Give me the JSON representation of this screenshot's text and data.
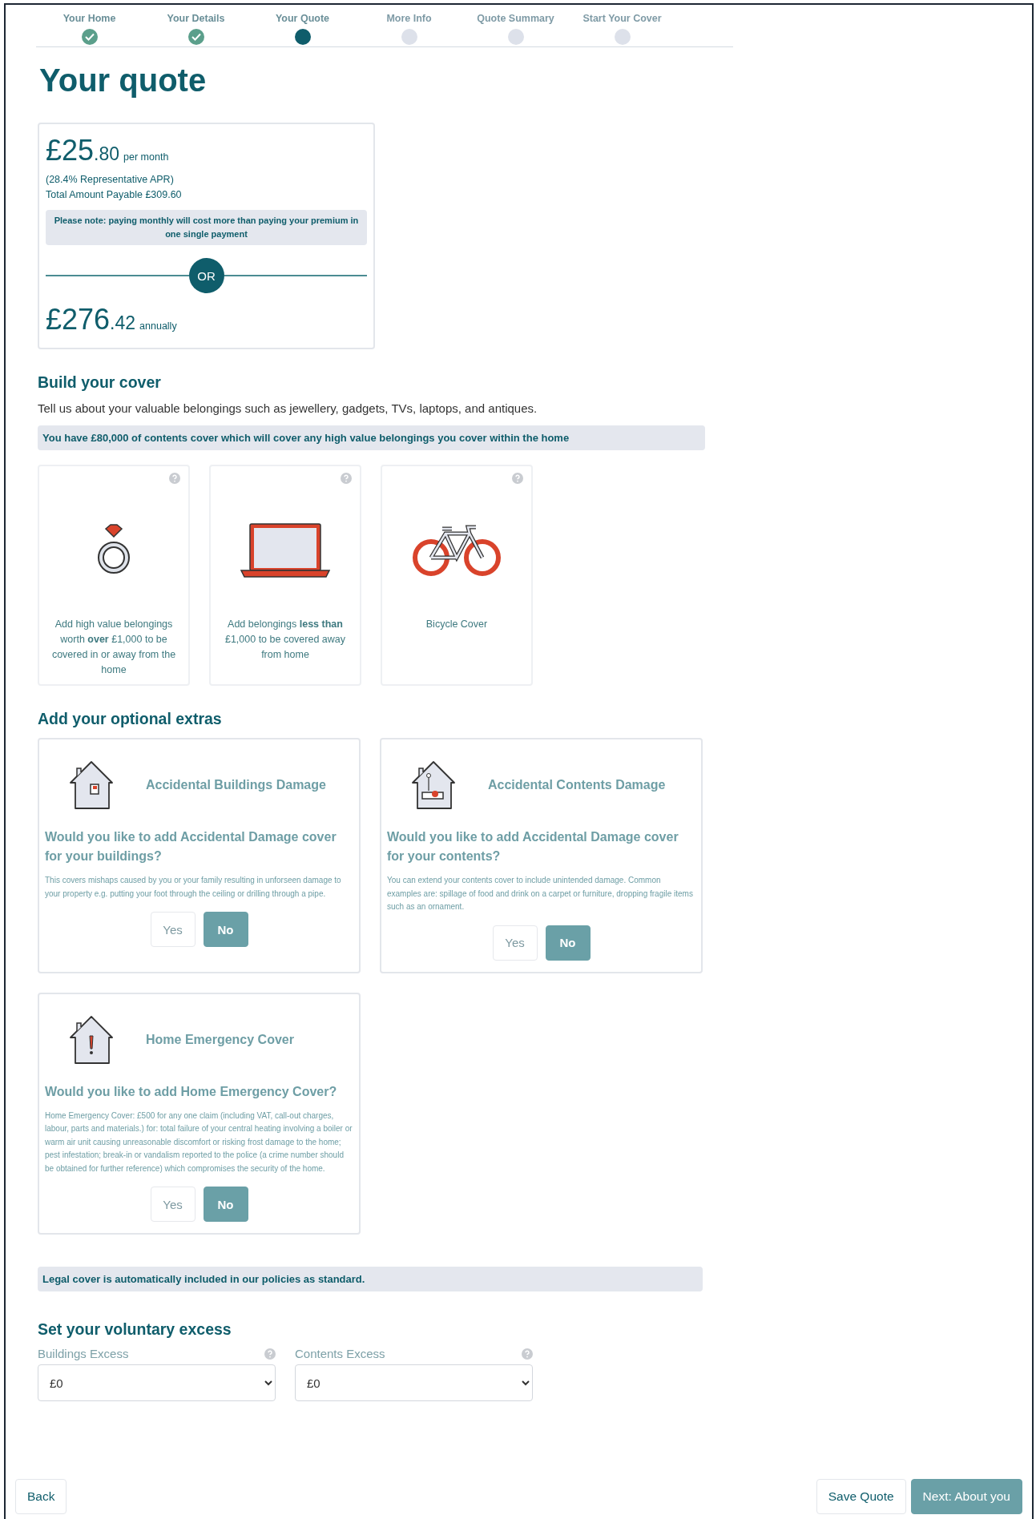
{
  "steps": [
    {
      "label": "Your Home",
      "completed": true,
      "selected": false
    },
    {
      "label": "Your Details",
      "completed": true,
      "selected": false
    },
    {
      "label": "Your Quote",
      "completed": false,
      "selected": true
    },
    {
      "label": "More Info",
      "completed": false,
      "selected": false
    },
    {
      "label": "Quote Summary",
      "completed": false,
      "selected": false
    },
    {
      "label": "Start Your Cover",
      "completed": false,
      "selected": false
    }
  ],
  "title": "Your quote",
  "quote": {
    "monthly": {
      "pounds": "£25",
      "pence": ".80",
      "period": "per month"
    },
    "apr": "(28.4% Representative APR)",
    "total": "Total Amount Payable £309.60",
    "note": "**Please note:** paying monthly will cost more than paying your premium in one single payment",
    "divider": "OR",
    "annual": {
      "pounds": "£276",
      "pence": ".42",
      "period": "annually"
    }
  },
  "build": {
    "heading": "Build your cover",
    "intro": "Tell us about your valuable belongings such as jewellery, gadgets, TVs, laptops, and antiques.",
    "info": "You have £80,000 of contents cover which will cover any high value belongings you cover within the home",
    "cards": [
      {
        "kind": "ring",
        "text": "Add high value belongings worth **over** £1,000 to be covered in or away from the home"
      },
      {
        "kind": "laptop",
        "text": "Add belongings **less than** £1,000 to be covered away from home"
      },
      {
        "kind": "bicycle",
        "text": "Bicycle Cover"
      }
    ]
  },
  "extras": {
    "heading": "Add your optional extras",
    "cards": [
      {
        "kind": "buildings",
        "title": "Accidental Buildings Damage",
        "question": "Would you like to add Accidental Damage cover for your buildings?",
        "description": "This covers mishaps caused by you or your family resulting in unforseen damage to your property e.g. putting your foot through the ceiling or drilling through a pipe.",
        "options": [
          {
            "label": "Yes",
            "selected": false
          },
          {
            "label": "No",
            "selected": true
          }
        ]
      },
      {
        "kind": "contents",
        "title": "Accidental Contents Damage",
        "question": "Would you like to add Accidental Damage cover for your contents?",
        "description": "You can extend your contents cover to include unintended damage. Common examples are: spillage of food and drink on a carpet or furniture, dropping fragile items such as an ornament.",
        "options": [
          {
            "label": "Yes",
            "selected": false
          },
          {
            "label": "No",
            "selected": true
          }
        ]
      },
      {
        "kind": "emergency",
        "title": "Home Emergency Cover",
        "question": "Would you like to add Home Emergency Cover?",
        "description": "Home Emergency Cover: £500 for any one claim (including VAT, call-out charges, labour, parts and materials.) for: total failure of your central heating involving a boiler or warm air unit causing unreasonable discomfort or risking frost damage to the home; pest infestation; break-in or vandalism reported to the police (a crime number should be obtained for further reference) which compromises the security of the home.",
        "options": [
          {
            "label": "Yes",
            "selected": false
          },
          {
            "label": "No",
            "selected": true
          }
        ]
      }
    ]
  },
  "legal": "Legal cover is automatically included in our policies as standard.",
  "excess": {
    "heading": "Set your voluntary excess",
    "fields": [
      {
        "label": "Buildings Excess",
        "value": "£0"
      },
      {
        "label": "Contents Excess",
        "value": "£0"
      }
    ]
  },
  "footer": {
    "back": "Back",
    "save": "Save Quote",
    "next": "Next: About you"
  }
}
